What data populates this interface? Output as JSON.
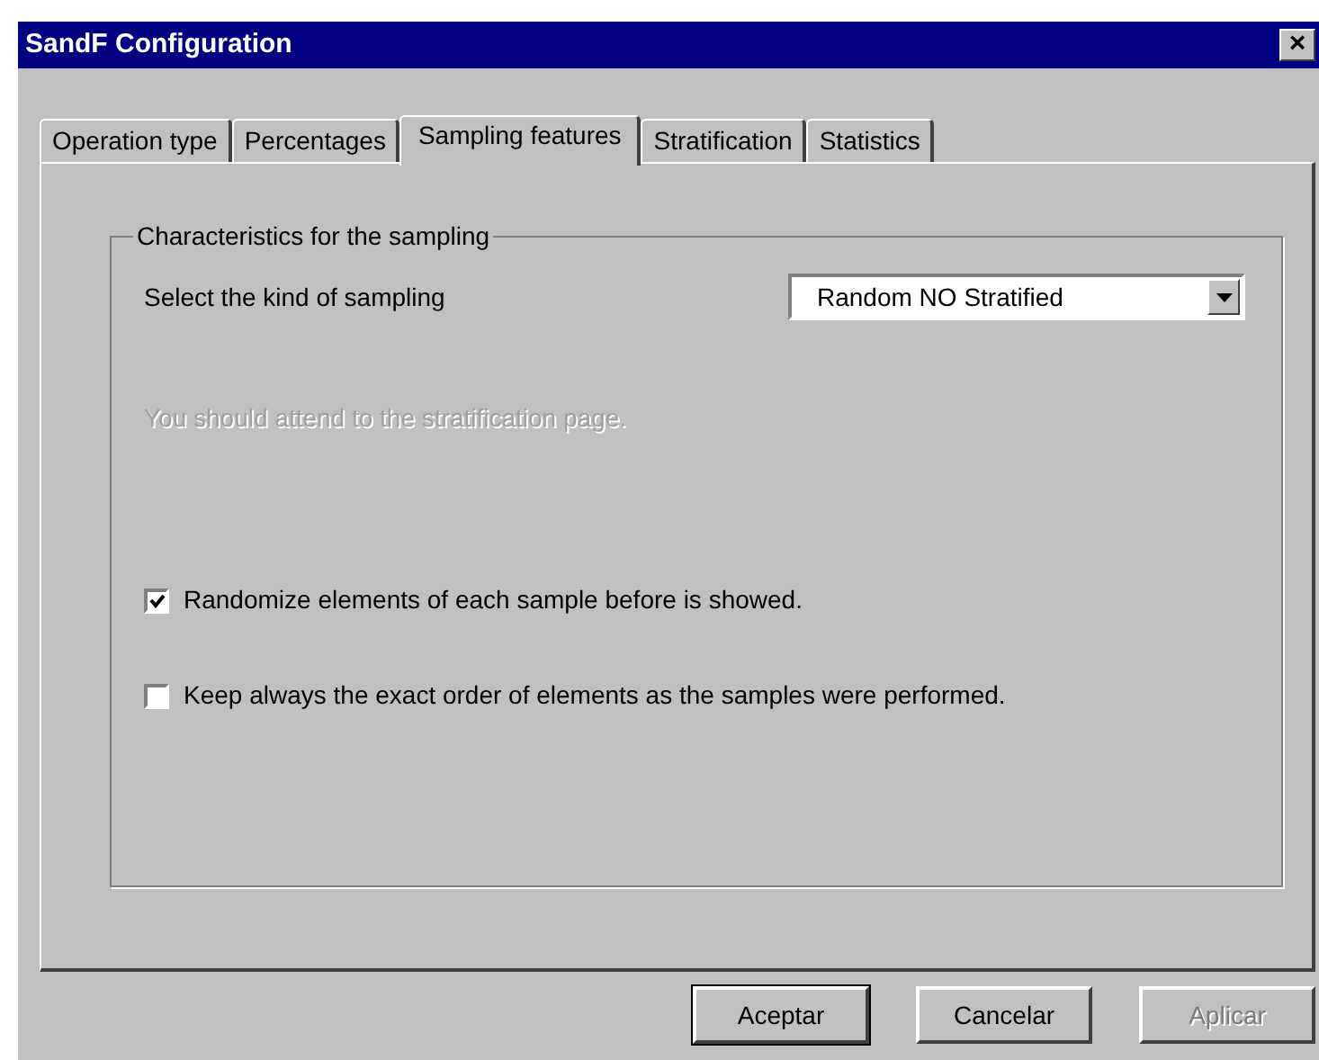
{
  "window": {
    "title": "SandF Configuration",
    "close": "×"
  },
  "tabs": [
    {
      "label": "Operation type",
      "selected": false
    },
    {
      "label": "Percentages",
      "selected": false
    },
    {
      "label": "Sampling features",
      "selected": true
    },
    {
      "label": "Stratification",
      "selected": false
    },
    {
      "label": "Statistics",
      "selected": false
    }
  ],
  "group": {
    "title": "Characteristics for the sampling",
    "sampling_kind": {
      "label": "Select the kind of sampling",
      "value": "Random NO Stratified"
    },
    "note": {
      "text": "You should attend to the stratification page.",
      "disabled": true
    },
    "options": [
      {
        "label": "Randomize elements of each sample before is showed.",
        "checked": true
      },
      {
        "label": "Keep always the exact order of elements as the samples were performed.",
        "checked": false
      }
    ]
  },
  "buttons": [
    {
      "label": "Aceptar",
      "default": true,
      "disabled": false
    },
    {
      "label": "Cancelar",
      "default": false,
      "disabled": false
    },
    {
      "label": "Aplicar",
      "default": false,
      "disabled": true
    }
  ]
}
